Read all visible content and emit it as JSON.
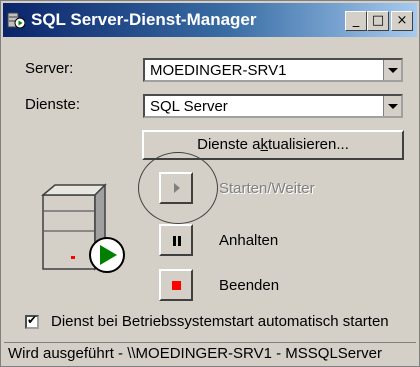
{
  "window": {
    "title": "SQL Server-Dienst-Manager",
    "minimize": "_",
    "maximize": "□",
    "close": "×"
  },
  "server": {
    "label": "Server:",
    "value": "MOEDINGER-SRV1"
  },
  "services": {
    "label": "Dienste:",
    "value": "SQL Server"
  },
  "refresh_button": {
    "pre": "Dienste a",
    "underlined": "k",
    "post": "tualisieren..."
  },
  "controls": {
    "start": {
      "label": "Starten/Weiter",
      "icon": "play-icon",
      "enabled": false
    },
    "pause": {
      "label": "Anhalten",
      "icon": "pause-icon"
    },
    "stop": {
      "label": "Beenden",
      "icon": "stop-icon",
      "color": "#ff0000"
    }
  },
  "autostart": {
    "label": "Dienst bei Betriebssystemstart automatisch starten",
    "checked": true
  },
  "status_bar": "Wird ausgeführt - \\\\MOEDINGER-SRV1 - MSSQLServer",
  "colors": {
    "title_start": "#0a246a",
    "title_end": "#a6caf0",
    "running_green": "#008000"
  }
}
